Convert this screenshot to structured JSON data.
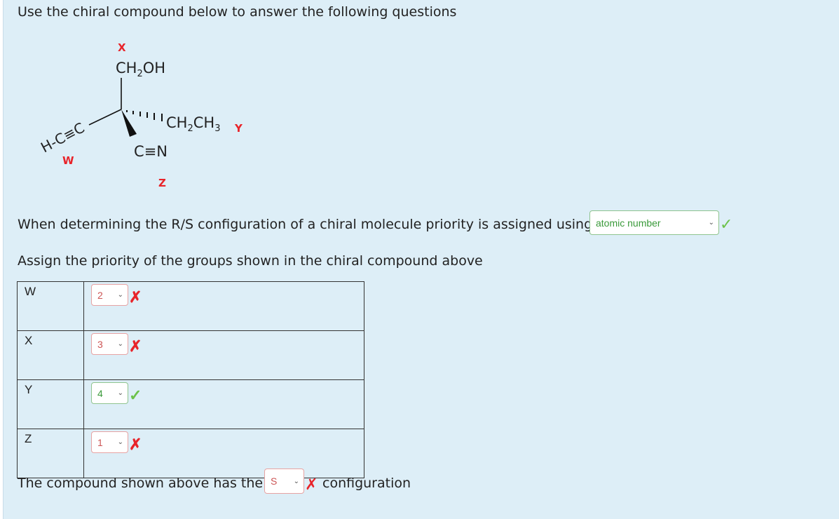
{
  "question_intro": "Use the chiral compound below to answer the following questions",
  "molecule": {
    "top_letter": "X",
    "top_group_main": "CH",
    "top_group_sub": "2",
    "top_group_tail": "OH",
    "right_group_a": "CH",
    "right_group_sub1": "2",
    "right_group_b": "CH",
    "right_group_sub2": "3",
    "right_letter": "Y",
    "left_group": "H-C≡C",
    "left_letter": "W",
    "bottom_group": "C≡N",
    "bottom_letter": "Z"
  },
  "q_priority_basis": {
    "text": "When determining the R/S configuration of a chiral molecule priority is assigned using",
    "selected": "atomic number",
    "status": "correct"
  },
  "q_assign": {
    "text": "Assign the priority of the groups shown in the chiral compound above",
    "rows": [
      {
        "label": "W",
        "selected": "2",
        "status": "incorrect"
      },
      {
        "label": "X",
        "selected": "3",
        "status": "incorrect"
      },
      {
        "label": "Y",
        "selected": "4",
        "status": "correct"
      },
      {
        "label": "Z",
        "selected": "1",
        "status": "incorrect"
      }
    ]
  },
  "q_config": {
    "text_before": "The compound shown above has the",
    "selected": "S",
    "text_after": "configuration",
    "status": "incorrect"
  },
  "icons": {
    "correct": "check-icon",
    "incorrect": "cross-icon",
    "dropdown": "chevron-down-icon"
  },
  "colors": {
    "panel_bg": "#ddeef7",
    "correct": "#6cc24a",
    "incorrect": "#e8242a"
  }
}
